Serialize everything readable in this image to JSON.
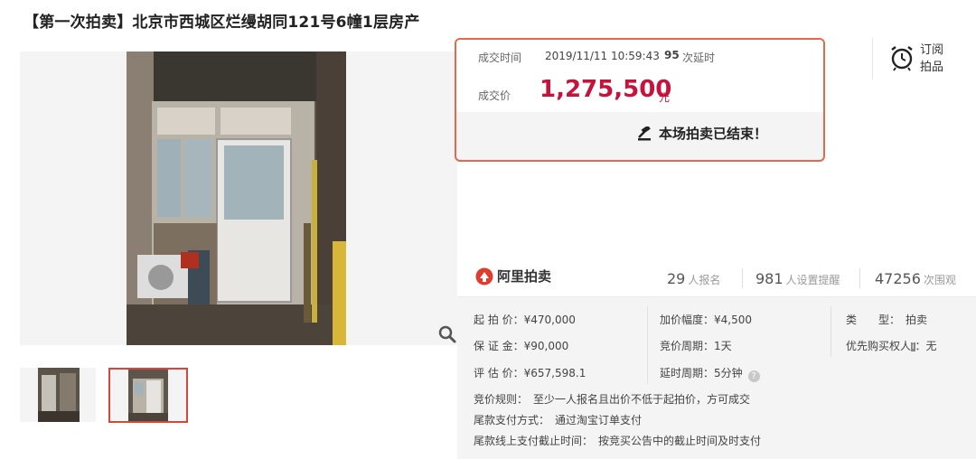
{
  "title": "【第一次拍卖】北京市西城区烂缦胡同121号6幢1层房产",
  "auction": {
    "deal_time_label": "成交时间",
    "deal_time": "2019/11/11 10:59:43",
    "delay_count": "95",
    "delay_label": "次延时",
    "price_label": "成交价",
    "price": "1,275,500",
    "price_unit": "元",
    "ended_text": "本场拍卖已结束！"
  },
  "subscribe": {
    "line1": "订阅",
    "line2": "拍品"
  },
  "platform": {
    "name": "阿里拍卖",
    "stats": [
      {
        "value": "29",
        "label": "人报名"
      },
      {
        "value": "981",
        "label": "人设置提醒"
      },
      {
        "value": "47256",
        "label": "次围观"
      }
    ]
  },
  "details": {
    "start_price": "起 拍 价：¥470,000",
    "deposit": "保 证 金：¥90,000",
    "valuation": "评 估 价：¥657,598.1",
    "increment": "加价幅度：¥4,500",
    "bid_cycle": "竞价周期：1天",
    "delay_cycle": "延时周期：5分钟",
    "type": "类　　型：　拍卖",
    "priority": "优先购买权人",
    "priority_value": "：无",
    "rule": "竞价规则：　至少一人报名且出价不低于起拍价，方可成交",
    "payment": "尾款支付方式：　通过淘宝订单支付",
    "deadline": "尾款线上支付截止时间：　按竞买公告中的截止时间及时支付"
  },
  "colors": {
    "price": "#c4143b",
    "highlight_border": "#e06a4a",
    "thumb_border": "#d8463a"
  }
}
